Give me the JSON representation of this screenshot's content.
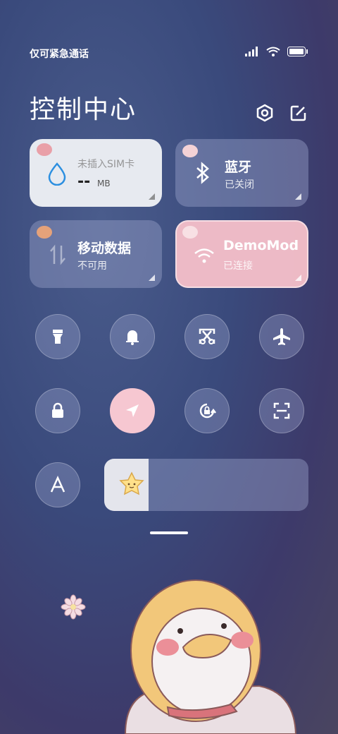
{
  "status_bar": {
    "carrier_text": "仅可紧急通话",
    "icons": [
      "signal-icon",
      "wifi-icon",
      "battery-icon"
    ]
  },
  "header": {
    "title": "控制中心",
    "icons": [
      "settings-icon",
      "edit-icon"
    ]
  },
  "tiles": {
    "data_usage": {
      "title": "未插入SIM卡",
      "value": "--",
      "unit": "MB"
    },
    "bluetooth": {
      "title": "蓝牙",
      "status": "已关闭"
    },
    "mobile_data": {
      "title": "移动数据",
      "status": "不可用"
    },
    "wifi": {
      "title": "DemoMod",
      "status": "已连接"
    }
  },
  "toggles": [
    {
      "name": "flashlight-icon",
      "active": false
    },
    {
      "name": "bell-icon",
      "active": false
    },
    {
      "name": "screenshot-icon",
      "active": false
    },
    {
      "name": "airplane-icon",
      "active": false
    },
    {
      "name": "lock-icon",
      "active": false
    },
    {
      "name": "location-icon",
      "active": true
    },
    {
      "name": "rotation-lock-icon",
      "active": false
    },
    {
      "name": "scan-icon",
      "active": false
    },
    {
      "name": "font-icon",
      "active": false
    }
  ],
  "brightness": {
    "level": 0.1,
    "thumb_icon": "star-icon"
  },
  "colors": {
    "accent_pink": "#f6c7d1",
    "wifi_tile": "#f3bec8",
    "blue_drop": "#2c8fe0"
  }
}
